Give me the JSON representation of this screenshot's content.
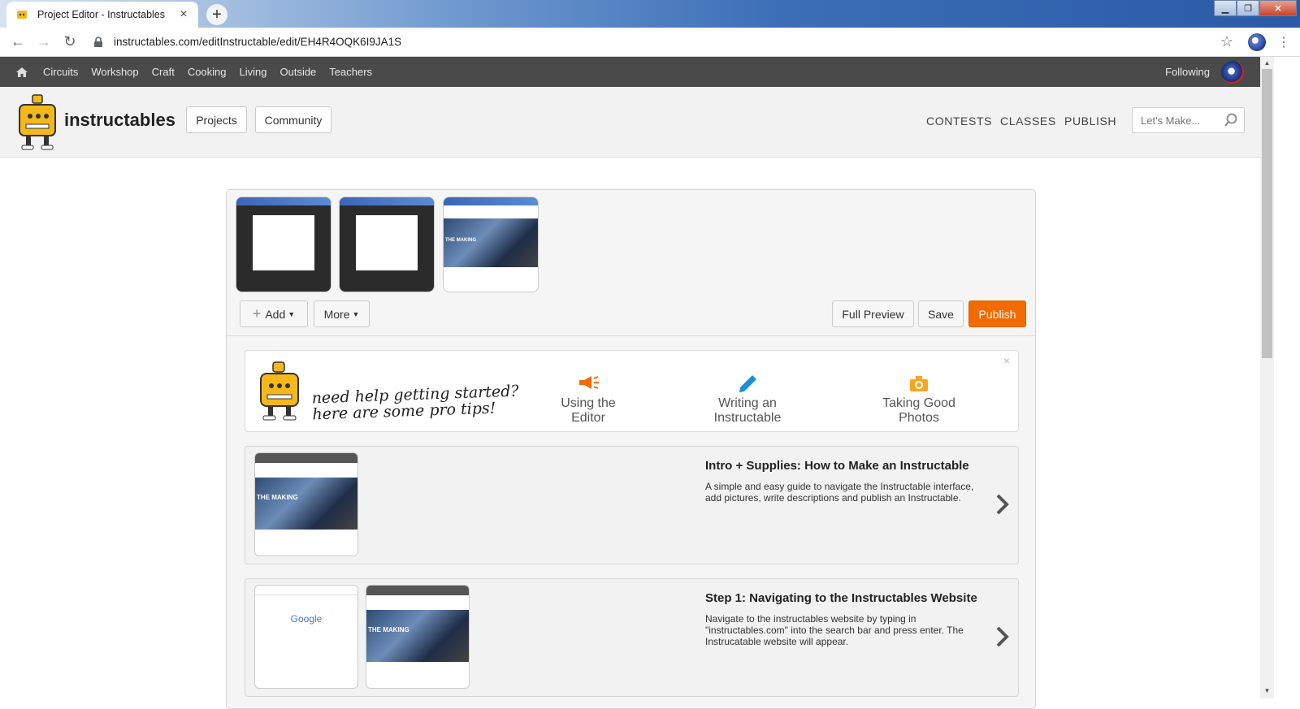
{
  "browser": {
    "tab_title": "Project Editor - Instructables",
    "tab_close": "×",
    "new_tab": "+",
    "url": "instructables.com/editInstructable/edit/EH4R4OQK6I9JA1S"
  },
  "site_nav": {
    "categories": [
      "Circuits",
      "Workshop",
      "Craft",
      "Cooking",
      "Living",
      "Outside",
      "Teachers"
    ],
    "following": "Following"
  },
  "header": {
    "brand": "instructables",
    "projects": "Projects",
    "community": "Community",
    "contests": "CONTESTS",
    "classes": "CLASSES",
    "publish": "PUBLISH",
    "search_placeholder": "Let's Make..."
  },
  "editor": {
    "add": "Add",
    "more": "More",
    "full_preview": "Full Preview",
    "save": "Save",
    "publish": "Publish",
    "thumb_text": "THE MAKING"
  },
  "tips": {
    "handwritten_line1": "need help getting started?",
    "handwritten_line2": "here are some pro tips!",
    "items": [
      "Using the Editor",
      "Writing an Instructable",
      "Taking Good Photos"
    ],
    "close": "×"
  },
  "steps": [
    {
      "title": "Intro + Supplies: How to Make an Instructable",
      "description": "A simple and easy guide to navigate the Instructable interface, add pictures, write descriptions and publish an Instructable."
    },
    {
      "title": "Step 1: Navigating to the Instructables Website",
      "description": "Navigate to the instructables website by typing in \"instructables.com\" into the search bar and press enter. The Instrucatable website will appear.",
      "thumb_text": "Google"
    }
  ],
  "colors": {
    "accent": "#f26b00",
    "nav_bg": "#4a4a4a"
  }
}
